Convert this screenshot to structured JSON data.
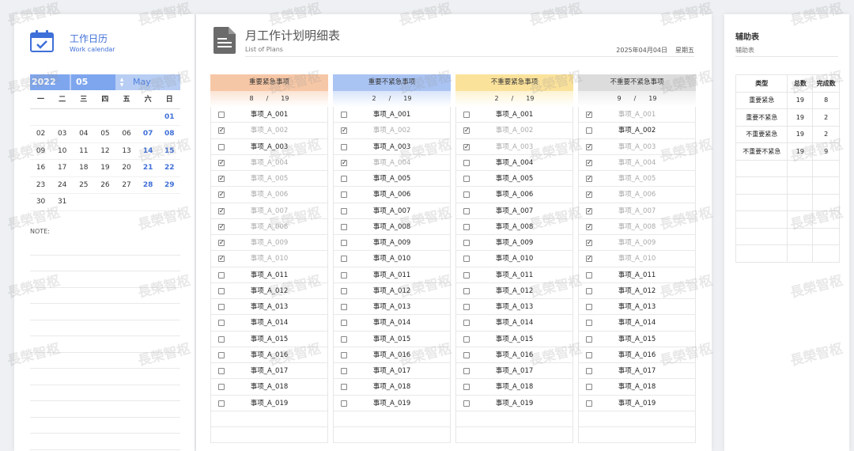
{
  "calendar": {
    "title": "工作日历",
    "subtitle": "Work calendar",
    "year": "2022",
    "month": "05",
    "month_name": "May",
    "weekdays": [
      "一",
      "二",
      "三",
      "四",
      "五",
      "六",
      "日"
    ],
    "weeks": [
      [
        "",
        "",
        "",
        "",
        "",
        "",
        "01"
      ],
      [
        "02",
        "03",
        "04",
        "05",
        "06",
        "07",
        "08"
      ],
      [
        "09",
        "10",
        "11",
        "12",
        "13",
        "14",
        "15"
      ],
      [
        "16",
        "17",
        "18",
        "19",
        "20",
        "21",
        "22"
      ],
      [
        "23",
        "24",
        "25",
        "26",
        "27",
        "28",
        "29"
      ],
      [
        "30",
        "31",
        "",
        "",
        "",
        "",
        ""
      ]
    ],
    "note_label": "NOTE:",
    "weekend_color": "#3f6fd8"
  },
  "plan": {
    "title": "月工作计划明细表",
    "subtitle": "List of Plans",
    "date": "2025年04月04日",
    "weekday": "星期五",
    "quadrants": [
      {
        "name": "重要紧急事项",
        "done": "8",
        "sep": "/",
        "total": "19",
        "head_color": "#f6c7a6",
        "count_color": "#fbe3d3",
        "items": [
          {
            "label": "事项_A_001",
            "checked": false,
            "mark": ""
          },
          {
            "label": "事项_A_002",
            "checked": true,
            "mark": "✓"
          },
          {
            "label": "事项_A_003",
            "checked": false,
            "mark": ""
          },
          {
            "label": "事项_A_004",
            "checked": true,
            "mark": "✓"
          },
          {
            "label": "事项_A_005",
            "checked": true,
            "mark": "✓"
          },
          {
            "label": "事项_A_006",
            "checked": true,
            "mark": "✓"
          },
          {
            "label": "事项_A_007",
            "checked": true,
            "mark": "✓"
          },
          {
            "label": "事项_A_008",
            "checked": true,
            "mark": "✓"
          },
          {
            "label": "事项_A_009",
            "checked": true,
            "mark": "✓"
          },
          {
            "label": "事项_A_010",
            "checked": true,
            "mark": "✓"
          },
          {
            "label": "事项_A_011",
            "checked": false,
            "mark": ""
          },
          {
            "label": "事项_A_012",
            "checked": false,
            "mark": ""
          },
          {
            "label": "事项_A_013",
            "checked": false,
            "mark": ""
          },
          {
            "label": "事项_A_014",
            "checked": false,
            "mark": ""
          },
          {
            "label": "事项_A_015",
            "checked": false,
            "mark": ""
          },
          {
            "label": "事项_A_016",
            "checked": false,
            "mark": ""
          },
          {
            "label": "事项_A_017",
            "checked": false,
            "mark": ""
          },
          {
            "label": "事项_A_018",
            "checked": false,
            "mark": ""
          },
          {
            "label": "事项_A_019",
            "checked": false,
            "mark": ""
          }
        ]
      },
      {
        "name": "重要不紧急事项",
        "done": "2",
        "sep": "/",
        "total": "19",
        "head_color": "#a9c3f2",
        "count_color": "#d9e5fa",
        "items": [
          {
            "label": "事项_A_001",
            "checked": false,
            "mark": ""
          },
          {
            "label": "事项_A_002",
            "checked": true,
            "mark": "✓"
          },
          {
            "label": "事项_A_003",
            "checked": false,
            "mark": ""
          },
          {
            "label": "事项_A_004",
            "checked": true,
            "mark": "✓"
          },
          {
            "label": "事项_A_005",
            "checked": false,
            "mark": ""
          },
          {
            "label": "事项_A_006",
            "checked": false,
            "mark": ""
          },
          {
            "label": "事项_A_007",
            "checked": false,
            "mark": ""
          },
          {
            "label": "事项_A_008",
            "checked": false,
            "mark": ""
          },
          {
            "label": "事项_A_009",
            "checked": false,
            "mark": ""
          },
          {
            "label": "事项_A_010",
            "checked": false,
            "mark": ""
          },
          {
            "label": "事项_A_011",
            "checked": false,
            "mark": ""
          },
          {
            "label": "事项_A_012",
            "checked": false,
            "mark": ""
          },
          {
            "label": "事项_A_013",
            "checked": false,
            "mark": ""
          },
          {
            "label": "事项_A_014",
            "checked": false,
            "mark": ""
          },
          {
            "label": "事项_A_015",
            "checked": false,
            "mark": ""
          },
          {
            "label": "事项_A_016",
            "checked": false,
            "mark": ""
          },
          {
            "label": "事项_A_017",
            "checked": false,
            "mark": ""
          },
          {
            "label": "事项_A_018",
            "checked": false,
            "mark": ""
          },
          {
            "label": "事项_A_019",
            "checked": false,
            "mark": ""
          }
        ]
      },
      {
        "name": "不重要紧急事项",
        "done": "2",
        "sep": "/",
        "total": "19",
        "head_color": "#fbe29b",
        "count_color": "#fdf3d2",
        "items": [
          {
            "label": "事项_A_001",
            "checked": false,
            "mark": ""
          },
          {
            "label": "事项_A_002",
            "checked": true,
            "mark": "✓"
          },
          {
            "label": "事项_A_003",
            "checked": true,
            "mark": "✓"
          },
          {
            "label": "事项_A_004",
            "checked": false,
            "mark": ""
          },
          {
            "label": "事项_A_005",
            "checked": false,
            "mark": ""
          },
          {
            "label": "事项_A_006",
            "checked": false,
            "mark": ""
          },
          {
            "label": "事项_A_007",
            "checked": false,
            "mark": ""
          },
          {
            "label": "事项_A_008",
            "checked": false,
            "mark": ""
          },
          {
            "label": "事项_A_009",
            "checked": false,
            "mark": ""
          },
          {
            "label": "事项_A_010",
            "checked": false,
            "mark": ""
          },
          {
            "label": "事项_A_011",
            "checked": false,
            "mark": ""
          },
          {
            "label": "事项_A_012",
            "checked": false,
            "mark": ""
          },
          {
            "label": "事项_A_013",
            "checked": false,
            "mark": ""
          },
          {
            "label": "事项_A_014",
            "checked": false,
            "mark": ""
          },
          {
            "label": "事项_A_015",
            "checked": false,
            "mark": ""
          },
          {
            "label": "事项_A_016",
            "checked": false,
            "mark": ""
          },
          {
            "label": "事项_A_017",
            "checked": false,
            "mark": ""
          },
          {
            "label": "事项_A_018",
            "checked": false,
            "mark": ""
          },
          {
            "label": "事项_A_019",
            "checked": false,
            "mark": ""
          }
        ]
      },
      {
        "name": "不重要不紧急事项",
        "done": "9",
        "sep": "/",
        "total": "19",
        "head_color": "#dcdcdc",
        "count_color": "#eeeeee",
        "items": [
          {
            "label": "事项_A_001",
            "checked": true,
            "mark": "✓"
          },
          {
            "label": "事项_A_002",
            "checked": false,
            "mark": ""
          },
          {
            "label": "事项_A_003",
            "checked": true,
            "mark": "✓"
          },
          {
            "label": "事项_A_004",
            "checked": true,
            "mark": "✓"
          },
          {
            "label": "事项_A_005",
            "checked": true,
            "mark": "✓"
          },
          {
            "label": "事项_A_006",
            "checked": true,
            "mark": "✓"
          },
          {
            "label": "事项_A_007",
            "checked": true,
            "mark": "✓"
          },
          {
            "label": "事项_A_008",
            "checked": true,
            "mark": "✓"
          },
          {
            "label": "事项_A_009",
            "checked": true,
            "mark": "✓"
          },
          {
            "label": "事项_A_010",
            "checked": true,
            "mark": "✓"
          },
          {
            "label": "事项_A_011",
            "checked": false,
            "mark": ""
          },
          {
            "label": "事项_A_012",
            "checked": false,
            "mark": ""
          },
          {
            "label": "事项_A_013",
            "checked": false,
            "mark": ""
          },
          {
            "label": "事项_A_014",
            "checked": false,
            "mark": ""
          },
          {
            "label": "事项_A_015",
            "checked": false,
            "mark": ""
          },
          {
            "label": "事项_A_016",
            "checked": false,
            "mark": ""
          },
          {
            "label": "事项_A_017",
            "checked": false,
            "mark": ""
          },
          {
            "label": "事项_A_018",
            "checked": false,
            "mark": ""
          },
          {
            "label": "事项_A_019",
            "checked": false,
            "mark": ""
          }
        ]
      }
    ]
  },
  "aux": {
    "title": "辅助表",
    "subtitle": "辅助表",
    "headers": [
      "类型",
      "总数",
      "完成数"
    ],
    "rows": [
      [
        "重要紧急",
        "19",
        "8"
      ],
      [
        "重要不紧急",
        "19",
        "2"
      ],
      [
        "不重要紧急",
        "19",
        "2"
      ],
      [
        "不重要不紧急",
        "19",
        "9"
      ]
    ]
  },
  "watermark": "長榮智枢"
}
